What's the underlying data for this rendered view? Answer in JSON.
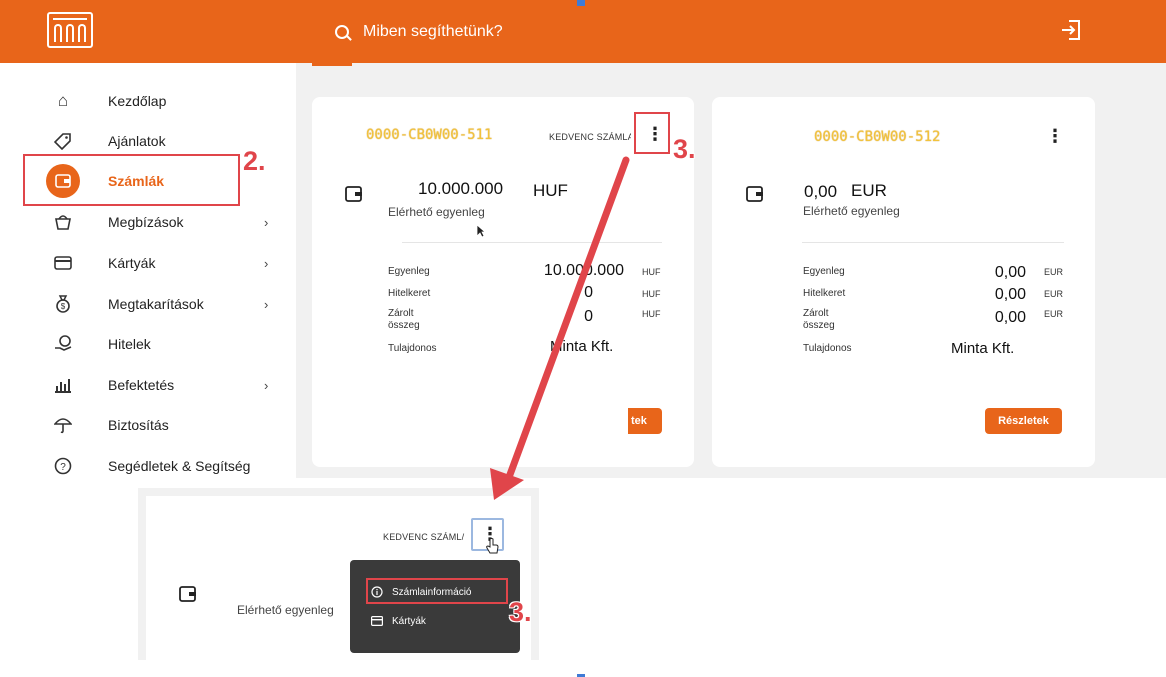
{
  "header": {
    "search_placeholder": "Miben segíthetünk?",
    "icons": {
      "logo": "bank-building-logo",
      "search": "search-icon",
      "logout": "logout-icon"
    }
  },
  "sidebar": {
    "items": [
      {
        "label": "Kezdőlap",
        "icon": "home-icon",
        "has_submenu": false
      },
      {
        "label": "Ajánlatok",
        "icon": "tag-icon",
        "has_submenu": false
      },
      {
        "label": "Számlák",
        "icon": "wallet-icon",
        "has_submenu": false,
        "active": true
      },
      {
        "label": "Megbízások",
        "icon": "basket-icon",
        "has_submenu": true
      },
      {
        "label": "Kártyák",
        "icon": "card-icon",
        "has_submenu": true
      },
      {
        "label": "Megtakarítások",
        "icon": "money-bag-icon",
        "has_submenu": true
      },
      {
        "label": "Hitelek",
        "icon": "hand-coin-icon",
        "has_submenu": false
      },
      {
        "label": "Befektetés",
        "icon": "bar-chart-icon",
        "has_submenu": true
      },
      {
        "label": "Biztosítás",
        "icon": "umbrella-icon",
        "has_submenu": false
      },
      {
        "label": "Segédletek & Segítség",
        "icon": "help-icon",
        "has_submenu": false
      }
    ],
    "chevron": "›"
  },
  "annotations": {
    "step2": "2.",
    "step3": "3.",
    "color": "#e0454a"
  },
  "cards": [
    {
      "account_number": "0000-CB0W00-511",
      "favorite_label": "KEDVENC SZÁMLA",
      "balance": "10.000.000",
      "currency": "HUF",
      "available_label": "Elérhető egyenleg",
      "rows": [
        {
          "label": "Egyenleg",
          "value": "10.000.000",
          "currency": "HUF"
        },
        {
          "label": "Hitelkeret",
          "value": "0",
          "currency": "HUF"
        },
        {
          "label": "Zárolt\nösszeg",
          "value": "0",
          "currency": "HUF"
        }
      ],
      "owner_label": "Tulajdonos",
      "owner": "Minta Kft.",
      "details_button": "tek"
    },
    {
      "account_number": "0000-CB0W00-512",
      "balance": "0,00",
      "currency": "EUR",
      "available_label": "Elérhető egyenleg",
      "rows": [
        {
          "label": "Egyenleg",
          "value": "0,00",
          "currency": "EUR"
        },
        {
          "label": "Hitelkeret",
          "value": "0,00",
          "currency": "EUR"
        },
        {
          "label": "Zárolt\nösszeg",
          "value": "0,00",
          "currency": "EUR"
        }
      ],
      "owner_label": "Tulajdonos",
      "owner": "Minta Kft.",
      "details_button": "Részletek"
    }
  ],
  "inset": {
    "favorite_label": "KEDVENC SZÁML/",
    "available_label": "Elérhető egyenleg",
    "menu": [
      {
        "label": "Számlainformáció",
        "icon": "info-circle-icon"
      },
      {
        "label": "Kártyák",
        "icon": "card-icon"
      }
    ]
  },
  "colors": {
    "brand": "#e8651a",
    "annotation": "#e0454a",
    "menu_bg": "#3a3a3a"
  }
}
